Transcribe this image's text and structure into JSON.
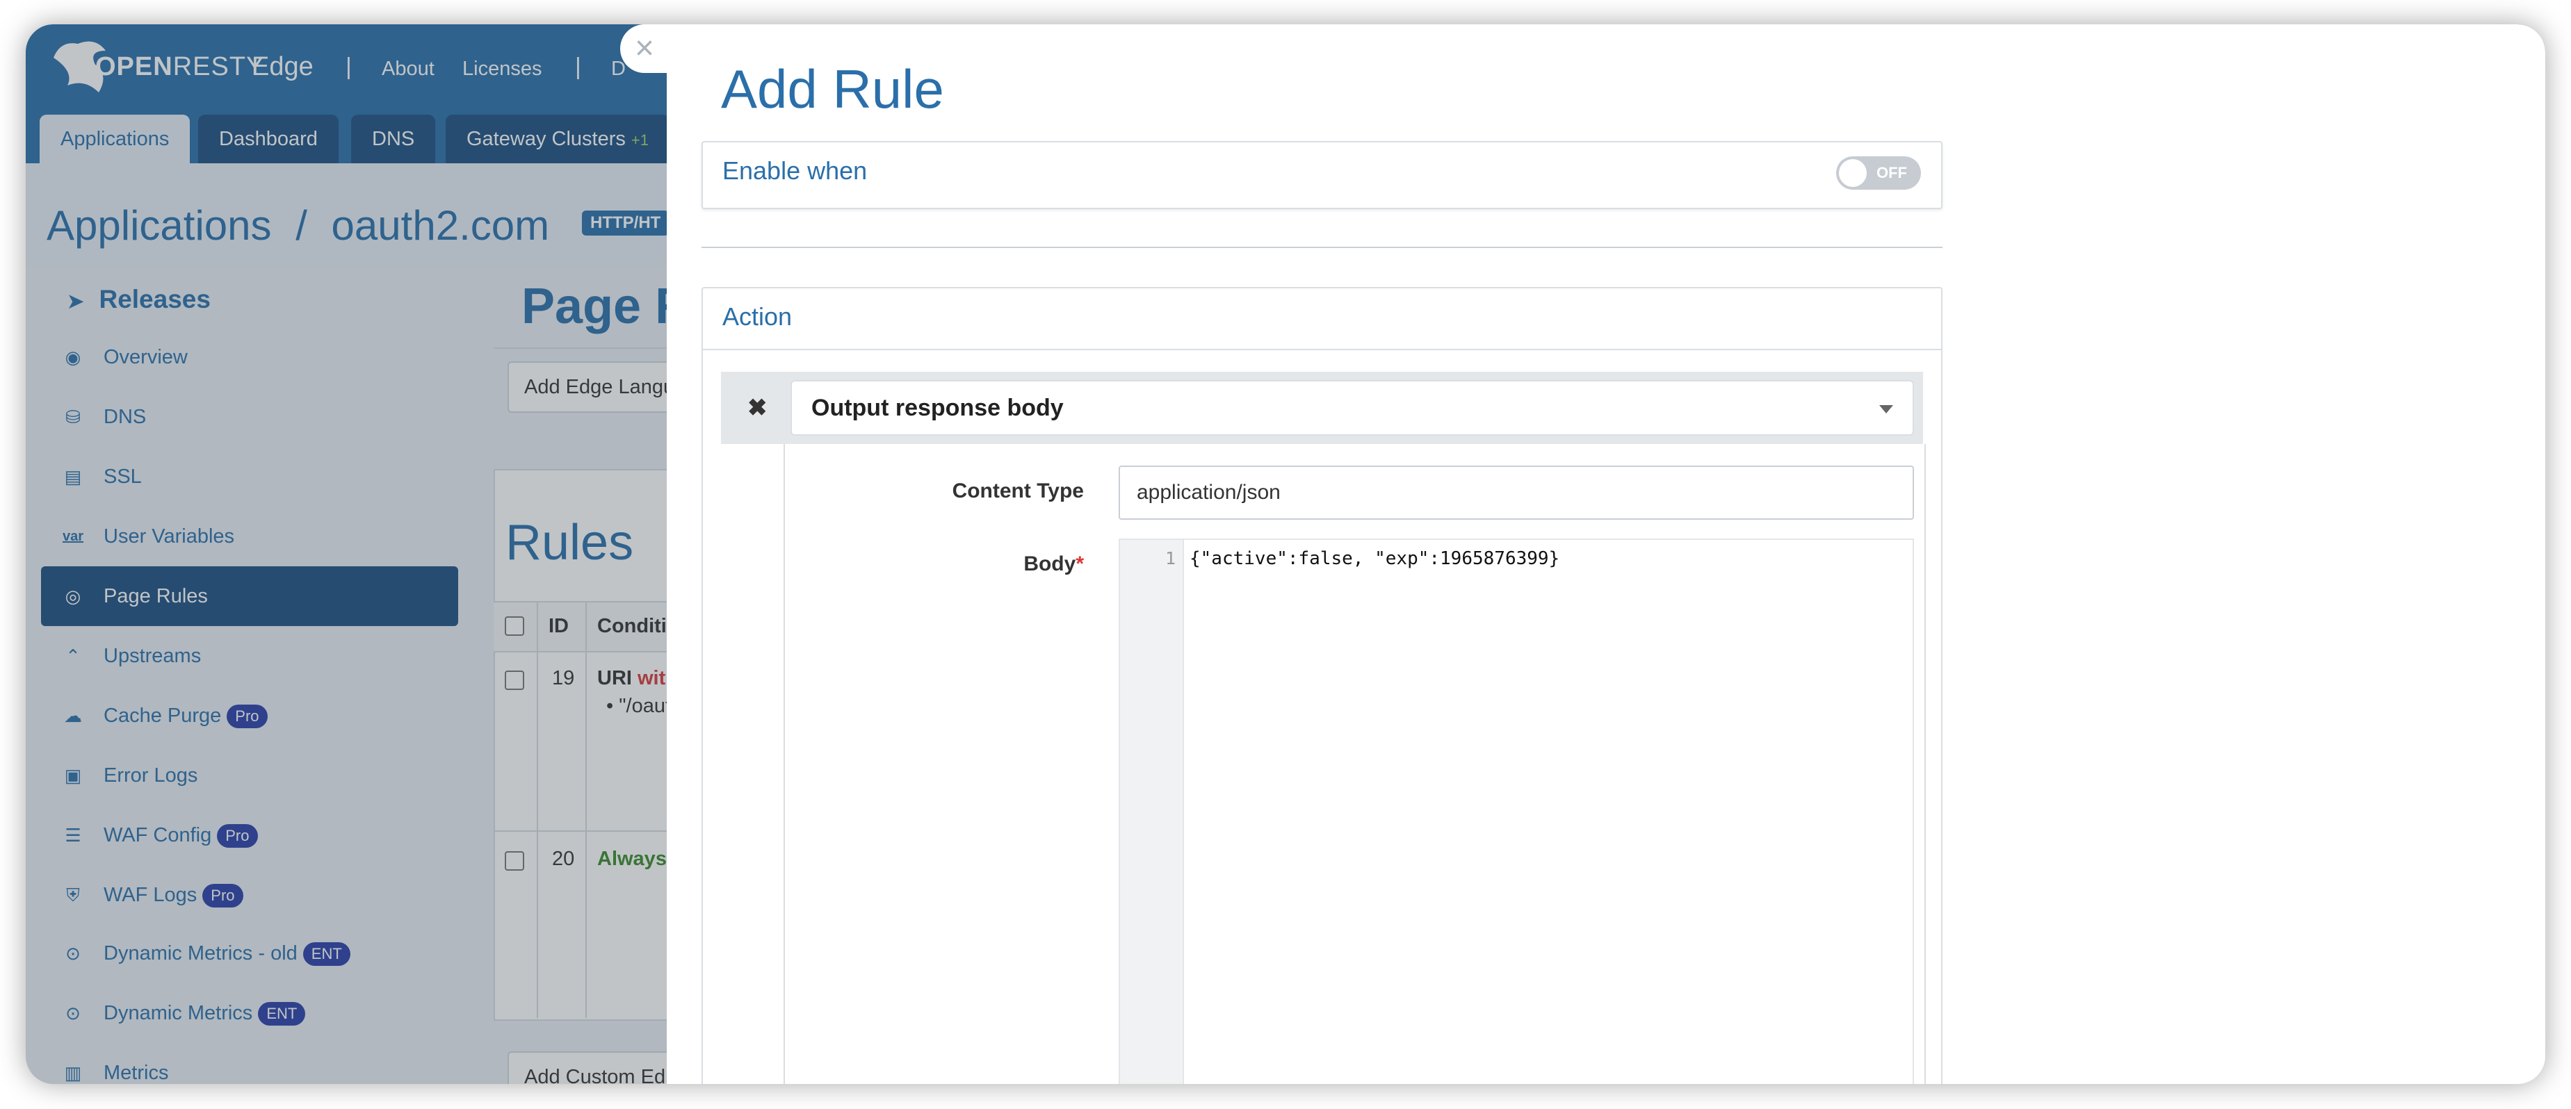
{
  "brand": {
    "logo_text_bold": "OPEN",
    "logo_text": "RESTY",
    "product": "Edge"
  },
  "topnav": {
    "about": "About",
    "licenses": "Licenses",
    "partial": "D"
  },
  "tabs": [
    {
      "label": "Applications",
      "active": true
    },
    {
      "label": "Dashboard"
    },
    {
      "label": "DNS"
    },
    {
      "label": "Gateway Clusters",
      "extra": "+1"
    }
  ],
  "breadcrumb": {
    "root": "Applications",
    "separator": "/",
    "app": "oauth2.com",
    "protocol": "HTTP/HT"
  },
  "sidebar": {
    "heading": "Releases",
    "items": [
      {
        "label": "Overview",
        "icon": "dashboard-icon"
      },
      {
        "label": "DNS",
        "icon": "dns-icon"
      },
      {
        "label": "SSL",
        "icon": "ssl-icon"
      },
      {
        "label": "User Variables",
        "icon": "var-icon",
        "icon_text": "var"
      },
      {
        "label": "Page Rules",
        "icon": "page-rules-icon",
        "active": true
      },
      {
        "label": "Upstreams",
        "icon": "upstreams-icon"
      },
      {
        "label": "Cache Purge",
        "icon": "cloud-icon",
        "badge": "Pro"
      },
      {
        "label": "Error Logs",
        "icon": "log-icon"
      },
      {
        "label": "WAF Config",
        "icon": "list-icon",
        "badge": "Pro"
      },
      {
        "label": "WAF Logs",
        "icon": "waf-logs-icon",
        "badge": "Pro"
      },
      {
        "label": "Dynamic Metrics - old",
        "icon": "metrics-pin-icon",
        "badge": "ENT"
      },
      {
        "label": "Dynamic Metrics",
        "icon": "metrics-pin-icon",
        "badge": "ENT"
      },
      {
        "label": "Metrics",
        "icon": "bar-chart-icon"
      }
    ]
  },
  "page": {
    "title": "Page R",
    "add_edge_button": "Add Edge Langu",
    "rules_heading": "Rules",
    "table_headers": {
      "id": "ID",
      "conditions": "Conditi"
    },
    "rows": [
      {
        "id": "19",
        "cond_prefix": "URI ",
        "cond_op": "wit",
        "bullet": "\"/oaut"
      },
      {
        "id": "20",
        "cond_always": "Always"
      }
    ],
    "add_custom_button": "Add Custom Ed"
  },
  "drawer": {
    "close_glyph": "×",
    "title": "Add Rule",
    "enable_when": {
      "label": "Enable when",
      "toggle_text": "OFF",
      "toggle_on": false
    },
    "action": {
      "label": "Action",
      "remove_glyph": "✖",
      "selected": "Output response body",
      "content_type_label": "Content Type",
      "content_type_value": "application/json",
      "body_label": "Body",
      "required_mark": "*",
      "code_line_number": "1",
      "code": "{\"active\":false, \"exp\":1965876399}"
    }
  },
  "colors": {
    "brand": "#2a6faa",
    "nav_dark": "#1c4f80",
    "badge": "#2a3fa8",
    "required": "#d9383a"
  }
}
